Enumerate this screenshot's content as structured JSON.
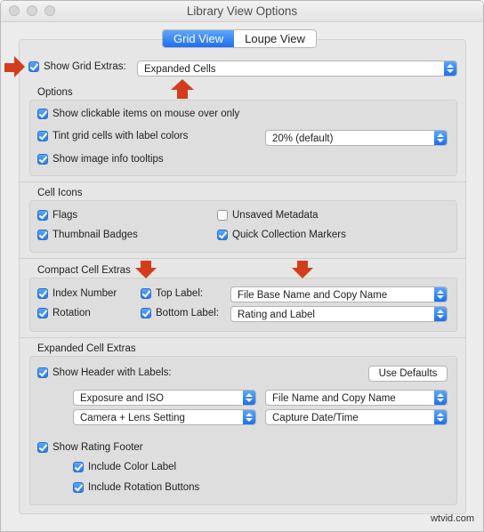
{
  "window": {
    "title": "Library View Options"
  },
  "tabs": {
    "grid_view": "Grid View",
    "loupe_view": "Loupe View",
    "active": "Grid View"
  },
  "top": {
    "show_grid_extras_label": "Show Grid Extras:",
    "show_grid_extras_checked": true,
    "grid_extras_value": "Expanded Cells"
  },
  "options": {
    "title": "Options",
    "show_clickable": {
      "label": "Show clickable items on mouse over only",
      "checked": true
    },
    "tint_cells": {
      "label": "Tint grid cells with label colors",
      "checked": true,
      "value": "20% (default)"
    },
    "show_tooltips": {
      "label": "Show image info tooltips",
      "checked": true
    }
  },
  "cell_icons": {
    "title": "Cell Icons",
    "flags": {
      "label": "Flags",
      "checked": true
    },
    "unsaved_metadata": {
      "label": "Unsaved Metadata",
      "checked": false
    },
    "thumbnail_badges": {
      "label": "Thumbnail Badges",
      "checked": true
    },
    "quick_collection": {
      "label": "Quick Collection Markers",
      "checked": true
    }
  },
  "compact": {
    "title": "Compact Cell Extras",
    "index_number": {
      "label": "Index Number",
      "checked": true
    },
    "rotation": {
      "label": "Rotation",
      "checked": true
    },
    "top_label": {
      "label": "Top Label:",
      "checked": true,
      "value": "File Base Name and Copy Name"
    },
    "bottom_label": {
      "label": "Bottom Label:",
      "checked": true,
      "value": "Rating and Label"
    }
  },
  "expanded": {
    "title": "Expanded Cell Extras",
    "show_header": {
      "label": "Show Header with Labels:",
      "checked": true
    },
    "use_defaults": "Use Defaults",
    "header_1": "Exposure and ISO",
    "header_2": "File Name and Copy Name",
    "header_3": "Camera + Lens Setting",
    "header_4": "Capture Date/Time",
    "show_rating_footer": {
      "label": "Show Rating Footer",
      "checked": true
    },
    "include_color_label": {
      "label": "Include Color Label",
      "checked": true
    },
    "include_rotation": {
      "label": "Include Rotation Buttons",
      "checked": true
    }
  },
  "watermark": "wtvid.com",
  "colors": {
    "accent": "#2a7bef",
    "annotation_arrow": "#d43c1e"
  }
}
